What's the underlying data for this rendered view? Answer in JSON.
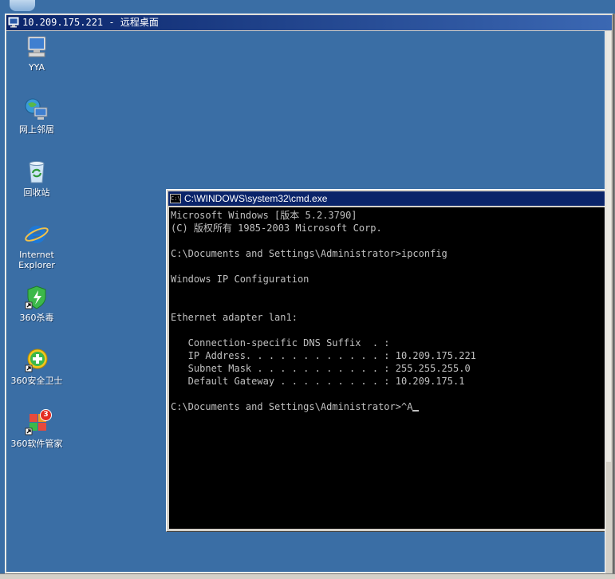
{
  "host": {
    "partial_icon": "recycle-bin-icon"
  },
  "window": {
    "title": "10.209.175.221 - 远程桌面",
    "icon": "remote-desktop-icon"
  },
  "desktop": {
    "icons": [
      {
        "label": "YYA",
        "icon": "computer-icon"
      },
      {
        "label": "网上邻居",
        "icon": "network-places-icon"
      },
      {
        "label": "回收站",
        "icon": "recycle-bin-icon"
      },
      {
        "label": "Internet\nExplorer",
        "icon": "internet-explorer-icon"
      },
      {
        "label": "360杀毒",
        "icon": "360-antivirus-icon"
      },
      {
        "label": "360安全卫士",
        "icon": "360-safeguard-icon"
      },
      {
        "label": "360软件管家",
        "icon": "360-software-manager-icon",
        "badge": "3"
      }
    ]
  },
  "cmd": {
    "title": "C:\\WINDOWS\\system32\\cmd.exe",
    "icon_text": "C:\\",
    "lines": [
      "Microsoft Windows [版本 5.2.3790]",
      "(C) 版权所有 1985-2003 Microsoft Corp.",
      "",
      "C:\\Documents and Settings\\Administrator>ipconfig",
      "",
      "Windows IP Configuration",
      "",
      "",
      "Ethernet adapter lan1:",
      "",
      "   Connection-specific DNS Suffix  . :",
      "   IP Address. . . . . . . . . . . . : 10.209.175.221",
      "   Subnet Mask . . . . . . . . . . . : 255.255.255.0",
      "   Default Gateway . . . . . . . . . : 10.209.175.1",
      "",
      "C:\\Documents and Settings\\Administrator>^A"
    ]
  },
  "colors": {
    "desktop": "#3a6ea5",
    "titlebar_active": "#0a246a",
    "console_bg": "#000000",
    "console_fg": "#c0c0c0"
  }
}
